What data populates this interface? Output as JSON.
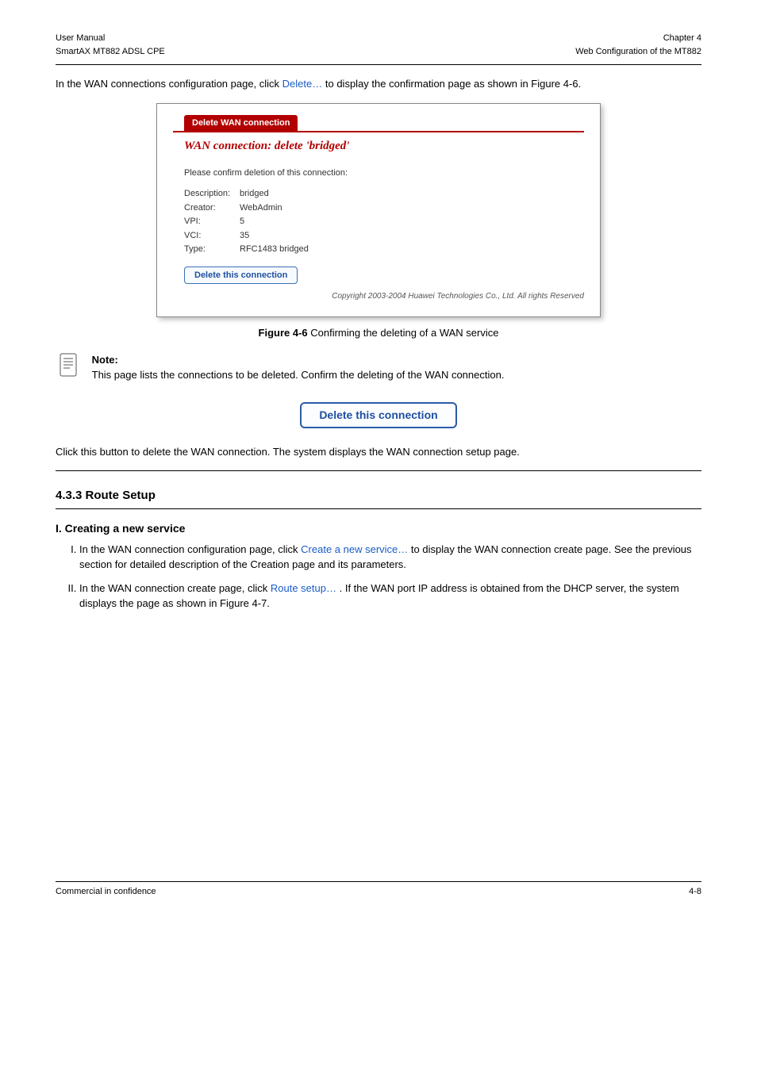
{
  "header": {
    "left_line1": "User Manual",
    "left_line2": "SmartAX MT882 ADSL CPE",
    "right_line1": "Chapter 4",
    "right_line2": "Web Configuration of the MT882"
  },
  "intro": {
    "text_before_link": "In the WAN connections configuration page, click ",
    "link": "Delete…",
    "text_after_link": " to display the confirmation page as shown in Figure 4-6."
  },
  "figure": {
    "tab_label": "Delete WAN connection",
    "title": "WAN connection: delete 'bridged'",
    "confirm_text": "Please confirm deletion of this connection:",
    "details": [
      {
        "label": "Description:",
        "value": "bridged"
      },
      {
        "label": "Creator:",
        "value": "WebAdmin"
      },
      {
        "label": "VPI:",
        "value": "5"
      },
      {
        "label": "VCI:",
        "value": "35"
      },
      {
        "label": "Type:",
        "value": "RFC1483 bridged"
      }
    ],
    "button": "Delete this connection",
    "copyright": "Copyright 2003-2004 Huawei Technologies Co., Ltd. All rights Reserved"
  },
  "figure_caption": {
    "bold": "Figure 4-6",
    "rest": " Confirming the deleting of a WAN service"
  },
  "note": {
    "label": "Note:",
    "text": "This page lists the connections to be deleted. Confirm the deleting of the WAN connection."
  },
  "big_button_label": "Delete this connection",
  "after_button_text": "Click this button to delete the WAN connection. The system displays the WAN connection setup page.",
  "section_heading": "4.3.3  Route Setup",
  "creating_heading": "I. Creating a new service",
  "steps": {
    "step1_before": "In the WAN connection configuration page, click ",
    "step1_link": "Create a new service…",
    "step1_after": " to display the WAN connection create page. See the previous section for detailed description of the Creation page and its parameters.",
    "step2_before": "In the WAN connection create page, click ",
    "step2_link": "Route setup…",
    "step2_after": ". If the WAN port IP address is obtained from the DHCP server, the system displays the page as shown in Figure 4-7."
  },
  "footer": {
    "left": "Commercial in confidence",
    "right": "4-8"
  }
}
